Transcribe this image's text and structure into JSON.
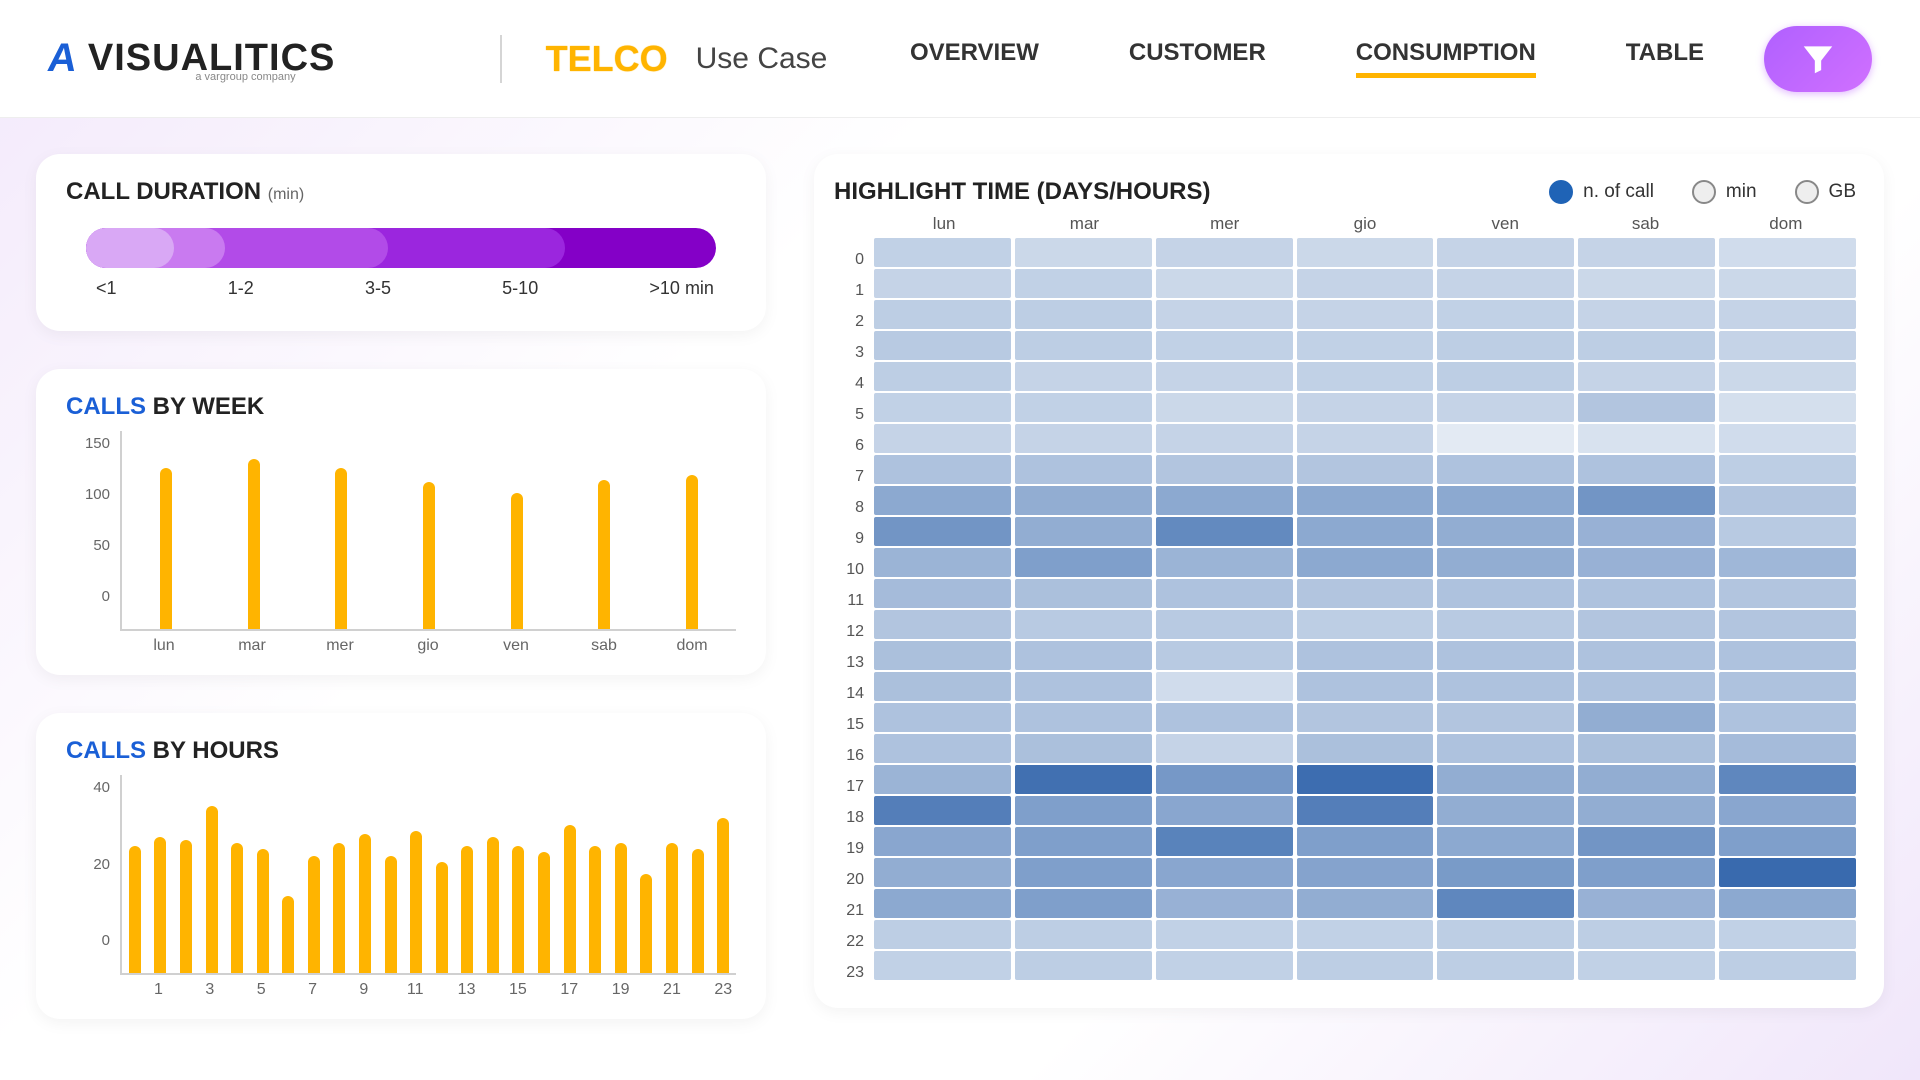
{
  "header": {
    "logo_text": "VISUALITICS",
    "logo_sub": "a vargroup company",
    "telco": "TELCO",
    "usecase": "Use Case",
    "nav": [
      "OVERVIEW",
      "CUSTOMER",
      "CONSUMPTION",
      "TABLE"
    ],
    "active_nav": 2
  },
  "call_duration": {
    "title": "CALL DURATION",
    "unit": "(min)",
    "segments": [
      {
        "label": "<1",
        "stop_pct": 14,
        "color": "#d9a8f5"
      },
      {
        "label": "1-2",
        "stop_pct": 22,
        "color": "#c97af0"
      },
      {
        "label": "3-5",
        "stop_pct": 48,
        "color": "#b24be8"
      },
      {
        "label": "5-10",
        "stop_pct": 76,
        "color": "#9b26de"
      },
      {
        "label": ">10 min",
        "stop_pct": 100,
        "color": "#8400c7"
      }
    ]
  },
  "calls_by_week": {
    "title_strong": "CALLS",
    "title_rest": " BY WEEK"
  },
  "calls_by_hours": {
    "title_strong": "CALLS",
    "title_rest": " BY HOURS"
  },
  "heatmap": {
    "title": "HIGHLIGHT TIME (DAYS/HOURS)",
    "legend": [
      {
        "label": "n. of call",
        "active": true
      },
      {
        "label": "min",
        "active": false
      },
      {
        "label": "GB",
        "active": false
      }
    ],
    "heat_scale_note": "values are relative intensity 0..1, rendered as blue shade"
  },
  "chart_data": [
    {
      "type": "bar",
      "id": "calls_by_week",
      "title": "CALLS BY WEEK",
      "ylabel": "",
      "ylim": [
        0,
        160
      ],
      "y_ticks": [
        150,
        100,
        50,
        0
      ],
      "categories": [
        "lun",
        "mar",
        "mer",
        "gio",
        "ven",
        "sab",
        "dom"
      ],
      "values": [
        152,
        160,
        152,
        138,
        128,
        140,
        145
      ]
    },
    {
      "type": "bar",
      "id": "calls_by_hours",
      "title": "CALLS BY HOURS",
      "ylabel": "",
      "ylim": [
        0,
        55
      ],
      "y_ticks": [
        40,
        20,
        0
      ],
      "categories": [
        "0",
        "1",
        "2",
        "3",
        "4",
        "5",
        "6",
        "7",
        "8",
        "9",
        "10",
        "11",
        "12",
        "13",
        "14",
        "15",
        "16",
        "17",
        "18",
        "19",
        "20",
        "21",
        "22",
        "23"
      ],
      "values": [
        41,
        44,
        43,
        54,
        42,
        40,
        25,
        38,
        42,
        45,
        38,
        46,
        36,
        41,
        44,
        41,
        39,
        48,
        41,
        42,
        32,
        42,
        40,
        50
      ]
    },
    {
      "type": "heatmap",
      "id": "highlight_time",
      "title": "HIGHLIGHT TIME (DAYS/HOURS)",
      "x_categories": [
        "lun",
        "mar",
        "mer",
        "gio",
        "ven",
        "sab",
        "dom"
      ],
      "y_categories": [
        "0",
        "1",
        "2",
        "3",
        "4",
        "5",
        "6",
        "7",
        "8",
        "9",
        "10",
        "11",
        "12",
        "13",
        "14",
        "15",
        "16",
        "17",
        "18",
        "19",
        "20",
        "21",
        "22",
        "23"
      ],
      "color_low": "#e7edf5",
      "color_high": "#2a5fa8",
      "series_name": "n. of call",
      "grid": [
        [
          0.2,
          0.15,
          0.18,
          0.15,
          0.18,
          0.18,
          0.12
        ],
        [
          0.18,
          0.2,
          0.15,
          0.18,
          0.18,
          0.15,
          0.15
        ],
        [
          0.22,
          0.22,
          0.18,
          0.18,
          0.2,
          0.18,
          0.18
        ],
        [
          0.25,
          0.22,
          0.2,
          0.2,
          0.22,
          0.22,
          0.18
        ],
        [
          0.22,
          0.18,
          0.18,
          0.2,
          0.22,
          0.18,
          0.15
        ],
        [
          0.2,
          0.2,
          0.15,
          0.18,
          0.18,
          0.28,
          0.1
        ],
        [
          0.18,
          0.18,
          0.18,
          0.18,
          0.02,
          0.08,
          0.12
        ],
        [
          0.3,
          0.3,
          0.28,
          0.28,
          0.3,
          0.3,
          0.22
        ],
        [
          0.48,
          0.45,
          0.48,
          0.48,
          0.48,
          0.62,
          0.28
        ],
        [
          0.62,
          0.45,
          0.7,
          0.48,
          0.45,
          0.42,
          0.25
        ],
        [
          0.4,
          0.55,
          0.4,
          0.48,
          0.45,
          0.42,
          0.38
        ],
        [
          0.35,
          0.32,
          0.3,
          0.28,
          0.3,
          0.3,
          0.28
        ],
        [
          0.28,
          0.25,
          0.25,
          0.22,
          0.25,
          0.28,
          0.28
        ],
        [
          0.32,
          0.3,
          0.25,
          0.3,
          0.3,
          0.3,
          0.3
        ],
        [
          0.32,
          0.3,
          0.12,
          0.3,
          0.3,
          0.3,
          0.3
        ],
        [
          0.3,
          0.3,
          0.3,
          0.28,
          0.28,
          0.45,
          0.3
        ],
        [
          0.3,
          0.32,
          0.18,
          0.32,
          0.3,
          0.32,
          0.35
        ],
        [
          0.4,
          0.88,
          0.6,
          0.9,
          0.45,
          0.45,
          0.72
        ],
        [
          0.78,
          0.55,
          0.5,
          0.78,
          0.45,
          0.45,
          0.5
        ],
        [
          0.5,
          0.55,
          0.75,
          0.55,
          0.48,
          0.62,
          0.55
        ],
        [
          0.45,
          0.55,
          0.5,
          0.52,
          0.58,
          0.55,
          0.92
        ],
        [
          0.48,
          0.55,
          0.42,
          0.45,
          0.72,
          0.42,
          0.48
        ],
        [
          0.22,
          0.22,
          0.2,
          0.2,
          0.22,
          0.22,
          0.2
        ],
        [
          0.2,
          0.22,
          0.2,
          0.22,
          0.22,
          0.2,
          0.22
        ]
      ]
    }
  ]
}
